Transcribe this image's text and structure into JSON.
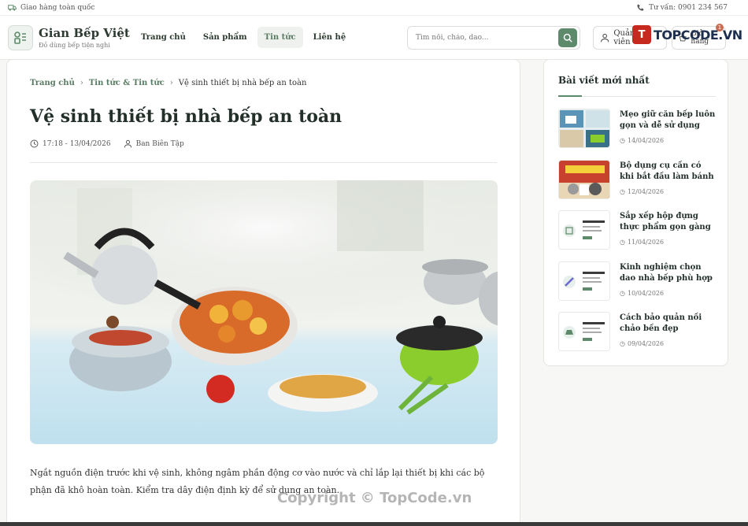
{
  "topbar": {
    "shipping": "Giao hàng toàn quốc",
    "hotline": "Tư vấn: 0901 234 567"
  },
  "brand": {
    "name": "Gian Bếp Việt",
    "tagline": "Đồ dùng bếp tiện nghi"
  },
  "nav": [
    {
      "label": "Trang chủ",
      "active": false
    },
    {
      "label": "Sản phẩm",
      "active": false
    },
    {
      "label": "Tin tức",
      "active": true
    },
    {
      "label": "Liên hệ",
      "active": false
    }
  ],
  "search": {
    "placeholder": "Tìm nồi, chảo, dao...",
    "value": ""
  },
  "account": {
    "label": "Quản trị viên"
  },
  "cart": {
    "label": "Giỏ hàng",
    "count": "1"
  },
  "watermark": {
    "mark": "T",
    "text": "TOPCODE.VN",
    "copyright": "Copyright © TopCode.vn"
  },
  "breadcrumb": {
    "home": "Trang chủ",
    "section": "Tin tức & Tin tức",
    "current": "Vệ sinh thiết bị nhà bếp an toàn"
  },
  "article": {
    "title": "Vệ sinh thiết bị nhà bếp an toàn",
    "datetime": "17:18 - 13/04/2026",
    "author": "Ban Biên Tập",
    "body": "Ngắt nguồn điện trước khi vệ sinh, không ngâm phần động cơ vào nước và chỉ lắp lại thiết bị khi các bộ phận đã khô hoàn toàn. Kiểm tra dây điện định kỳ để sử dụng an toàn."
  },
  "sidebar": {
    "title": "Bài viết mới nhất",
    "posts": [
      {
        "title": "Mẹo giữ căn bếp luôn gọn và dễ sử dụng",
        "date": "14/04/2026",
        "thumb": "collage"
      },
      {
        "title": "Bộ dụng cụ cần có khi bắt đầu làm bánh",
        "date": "12/04/2026",
        "thumb": "sale"
      },
      {
        "title": "Sắp xếp hộp đựng thực phẩm gọn gàng",
        "date": "11/04/2026",
        "thumb": "card-box"
      },
      {
        "title": "Kinh nghiệm chọn dao nhà bếp phù hợp",
        "date": "10/04/2026",
        "thumb": "card-knife"
      },
      {
        "title": "Cách bảo quản nồi chảo bền đẹp",
        "date": "09/04/2026",
        "thumb": "card-pot"
      }
    ]
  },
  "colors": {
    "accent": "#5d8a6a",
    "title": "#23302a",
    "badge": "#c96e52"
  }
}
